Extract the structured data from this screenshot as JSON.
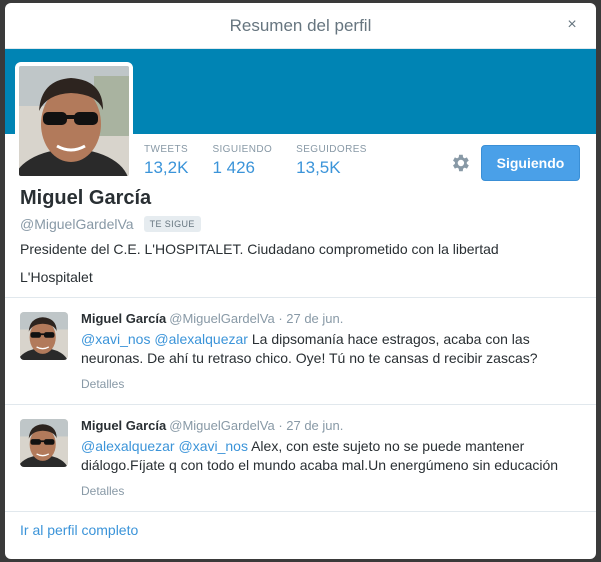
{
  "modal": {
    "title": "Resumen del perfil",
    "close_glyph": "×"
  },
  "colors": {
    "banner": "#0084b4",
    "link": "#3b94d9",
    "follow_button": "#4aa0e8"
  },
  "profile": {
    "stats": [
      {
        "label": "TWEETS",
        "value": "13,2K"
      },
      {
        "label": "SIGUIENDO",
        "value": "1 426"
      },
      {
        "label": "SEGUIDORES",
        "value": "13,5K"
      }
    ],
    "settings_icon": "gear-icon",
    "follow_button_label": "Siguiendo",
    "name": "Miguel García",
    "handle": "@MiguelGardelVa",
    "follows_you_badge": "TE SIGUE",
    "bio": "Presidente del C.E. L'HOSPITALET. Ciudadano comprometido con la libertad",
    "location": "L'Hospitalet"
  },
  "tweets": [
    {
      "name": "Miguel García",
      "handle": "@MiguelGardelVa",
      "date": " · 27 de jun.",
      "mentions": [
        "@xavi_nos",
        "@alexalquezar"
      ],
      "text_line1": " La dipsomanía hace estragos, acaba con las",
      "text_line2": "neuronas. De ahí tu retraso chico. Oye! Tú no te cansas d recibir zascas?",
      "details": "Detalles"
    },
    {
      "name": "Miguel García",
      "handle": "@MiguelGardelVa",
      "date": " · 27 de jun.",
      "mentions": [
        "@alexalquezar",
        "@xavi_nos"
      ],
      "text_line1": " Alex, con este sujeto no se puede  mantener",
      "text_line2": "diálogo.Fíjate q con todo el mundo acaba mal.Un energúmeno sin educación",
      "details": "Detalles"
    }
  ],
  "footer": {
    "full_profile_link": "Ir al perfil completo"
  }
}
